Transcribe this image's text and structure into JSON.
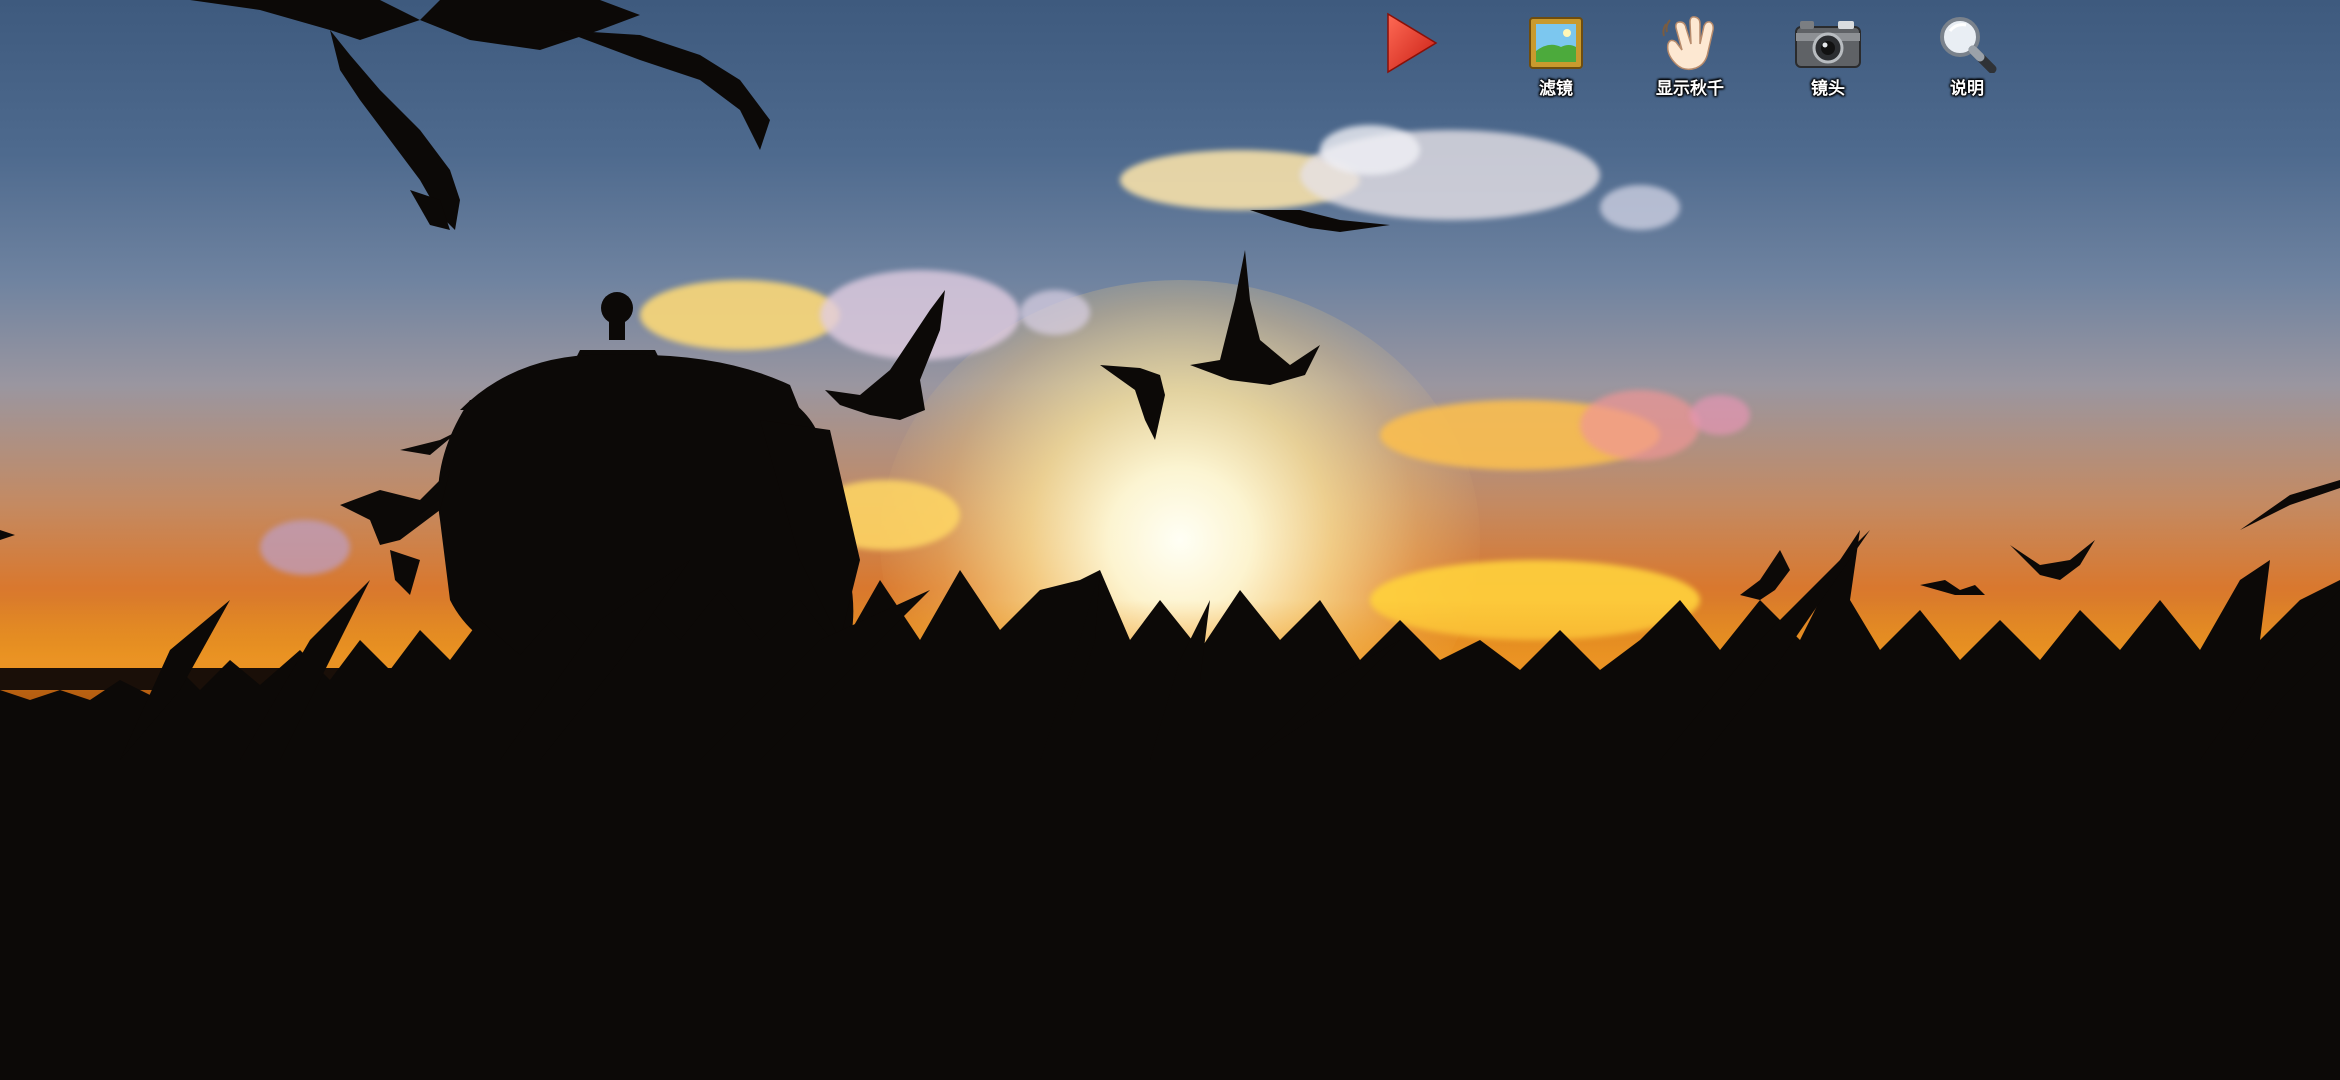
{
  "toolbar": {
    "play": {
      "label": "",
      "icon": "play-icon",
      "color": "#e23a2a"
    },
    "filter": {
      "label": "滤镜",
      "icon": "framed-picture-icon"
    },
    "swing": {
      "label": "显示秋千",
      "icon": "waving-hand-icon"
    },
    "lens": {
      "label": "镜头",
      "icon": "camera-icon"
    },
    "help": {
      "label": "说明",
      "icon": "magnifier-icon"
    }
  },
  "scene": {
    "sky_colors": [
      "#3e5a7e",
      "#6f83a0",
      "#d9782e",
      "#f0a020"
    ],
    "silhouette_color": "#0c0907"
  }
}
